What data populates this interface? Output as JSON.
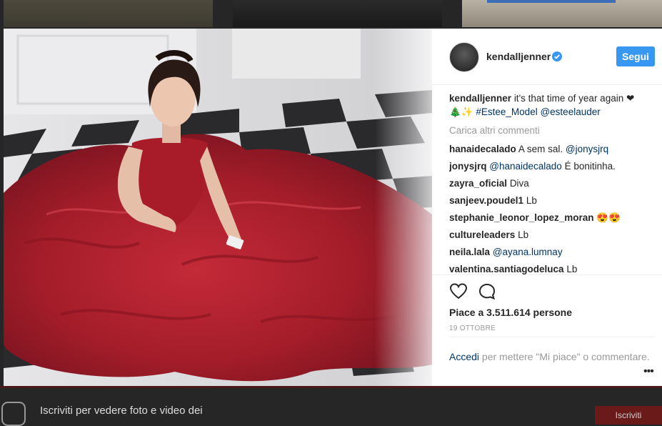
{
  "post": {
    "username": "kendalljenner",
    "follow_label": "Segui",
    "caption": {
      "username": "kendalljenner",
      "text": "it's that time of year again ❤",
      "emoji": "🎄✨",
      "hashtag": "#Estee_Model",
      "mention": "@esteelauder"
    },
    "load_more_label": "Carica altri commenti",
    "comments": [
      {
        "user": "hanaidecalado",
        "text": "A sem sal.",
        "mention": "@jonysjrq"
      },
      {
        "user": "jonysjrq",
        "mention": "@hanaidecalado",
        "text": "É bonitinha."
      },
      {
        "user": "zayra_oficial",
        "text": "Diva"
      },
      {
        "user": "sanjeev.poudel1",
        "text": "Lb"
      },
      {
        "user": "stephanie_leonor_lopez_moran",
        "text": "😍😍"
      },
      {
        "user": "cultureleaders",
        "text": "Lb"
      },
      {
        "user": "neila.lala",
        "mention": "@ayana.lumnay"
      },
      {
        "user": "valentina.santiagodeluca",
        "text": "Lb"
      }
    ],
    "likes_label": "Piace a 3.511.614 persone",
    "date": "19 OTTOBRE",
    "login_link": "Accedi",
    "login_text": "per mettere \"Mi piace\" o commentare.",
    "more_options": "•••"
  },
  "footer": {
    "signup_text": "Iscriviti per vedere foto e video dei",
    "signup_button": "Iscriviti"
  },
  "colors": {
    "accent": "#3897f0",
    "link": "#003569",
    "muted": "#999999",
    "dress_red": "#b01e2c"
  }
}
